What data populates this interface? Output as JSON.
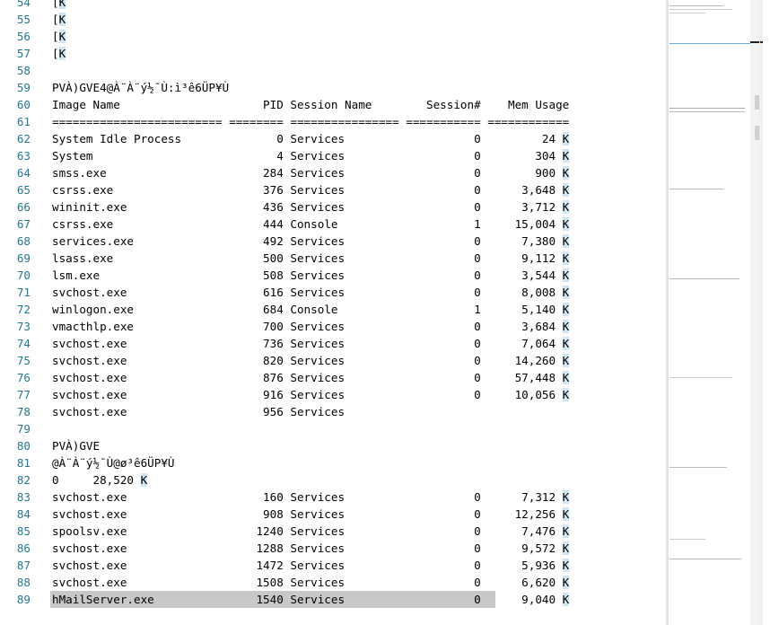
{
  "editor": {
    "lines": [
      {
        "n": "54",
        "t": "[K"
      },
      {
        "n": "55",
        "t": "[K"
      },
      {
        "n": "56",
        "t": "[K"
      },
      {
        "n": "57",
        "t": "[K"
      },
      {
        "n": "58",
        "t": ""
      },
      {
        "n": "59",
        "t": "PVÀ)GVE4@À¨À¨ý½¯Ù:ì³ê6ÜP¥Ù"
      },
      {
        "n": "60",
        "t": "Image Name                     PID Session Name        Session#    Mem Usage"
      },
      {
        "n": "61",
        "t": "========================= ======== ================ =========== ============"
      },
      {
        "n": "62",
        "t": "System Idle Process              0 Services                   0         24 K"
      },
      {
        "n": "63",
        "t": "System                           4 Services                   0        304 K"
      },
      {
        "n": "64",
        "t": "smss.exe                       284 Services                   0        900 K"
      },
      {
        "n": "65",
        "t": "csrss.exe                      376 Services                   0      3,648 K"
      },
      {
        "n": "66",
        "t": "wininit.exe                    436 Services                   0      3,712 K"
      },
      {
        "n": "67",
        "t": "csrss.exe                      444 Console                    1     15,004 K"
      },
      {
        "n": "68",
        "t": "services.exe                   492 Services                   0      7,380 K"
      },
      {
        "n": "69",
        "t": "lsass.exe                      500 Services                   0      9,112 K"
      },
      {
        "n": "70",
        "t": "lsm.exe                        508 Services                   0      3,544 K"
      },
      {
        "n": "71",
        "t": "svchost.exe                    616 Services                   0      8,008 K"
      },
      {
        "n": "72",
        "t": "winlogon.exe                   684 Console                    1      5,140 K"
      },
      {
        "n": "73",
        "t": "vmacthlp.exe                   700 Services                   0      3,684 K"
      },
      {
        "n": "74",
        "t": "svchost.exe                    736 Services                   0      7,064 K"
      },
      {
        "n": "75",
        "t": "svchost.exe                    820 Services                   0     14,260 K"
      },
      {
        "n": "76",
        "t": "svchost.exe                    876 Services                   0     57,448 K"
      },
      {
        "n": "77",
        "t": "svchost.exe                    916 Services                   0     10,056 K"
      },
      {
        "n": "78",
        "t": "svchost.exe                    956 Services"
      },
      {
        "n": "79",
        "t": ""
      },
      {
        "n": "80",
        "t": "PVÀ)GVE"
      },
      {
        "n": "81",
        "t": "@À¨À¨ý½¯Ù@ø³ê6ÜP¥Ù"
      },
      {
        "n": "82",
        "t": "0     28,520 K"
      },
      {
        "n": "83",
        "t": "svchost.exe                    160 Services                   0      7,312 K"
      },
      {
        "n": "84",
        "t": "svchost.exe                    908 Services                   0     12,256 K"
      },
      {
        "n": "85",
        "t": "spoolsv.exe                   1240 Services                   0      7,476 K"
      },
      {
        "n": "86",
        "t": "svchost.exe                   1288 Services                   0      9,572 K"
      },
      {
        "n": "87",
        "t": "svchost.exe                   1472 Services                   0      5,936 K"
      },
      {
        "n": "88",
        "t": "svchost.exe                   1508 Services                   0      6,620 K"
      },
      {
        "n": "89",
        "t": "hMailServer.exe               1540 Services                   0      9,040 K"
      }
    ]
  },
  "colors": {
    "line_number": "#237893",
    "highlight": "#cfe6f5",
    "selected_row": "#c8c8c8"
  }
}
